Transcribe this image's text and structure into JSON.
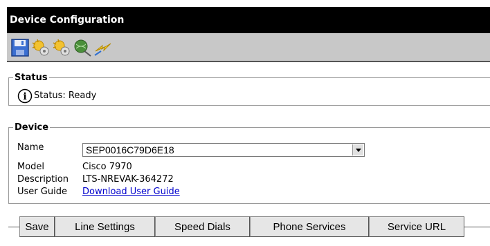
{
  "title": "Device Configuration",
  "toolbar": {
    "icons": [
      "save-icon",
      "gear-sun-icon",
      "gear-sun-icon-2",
      "network-icon",
      "lightning-icon"
    ]
  },
  "status": {
    "legend": "Status",
    "text": "Status: Ready"
  },
  "device": {
    "legend": "Device",
    "name_label": "Name",
    "name_value": "SEP0016C79D6E18",
    "model_label": "Model",
    "model_value": "Cisco 7970",
    "description_label": "Description",
    "description_value": "LTS-NREVAK-364272",
    "user_guide_label": "User Guide",
    "user_guide_link": "Download User Guide"
  },
  "tabs": [
    "Save",
    "Line Settings",
    "Speed Dials",
    "Phone Services",
    "Service URL"
  ]
}
